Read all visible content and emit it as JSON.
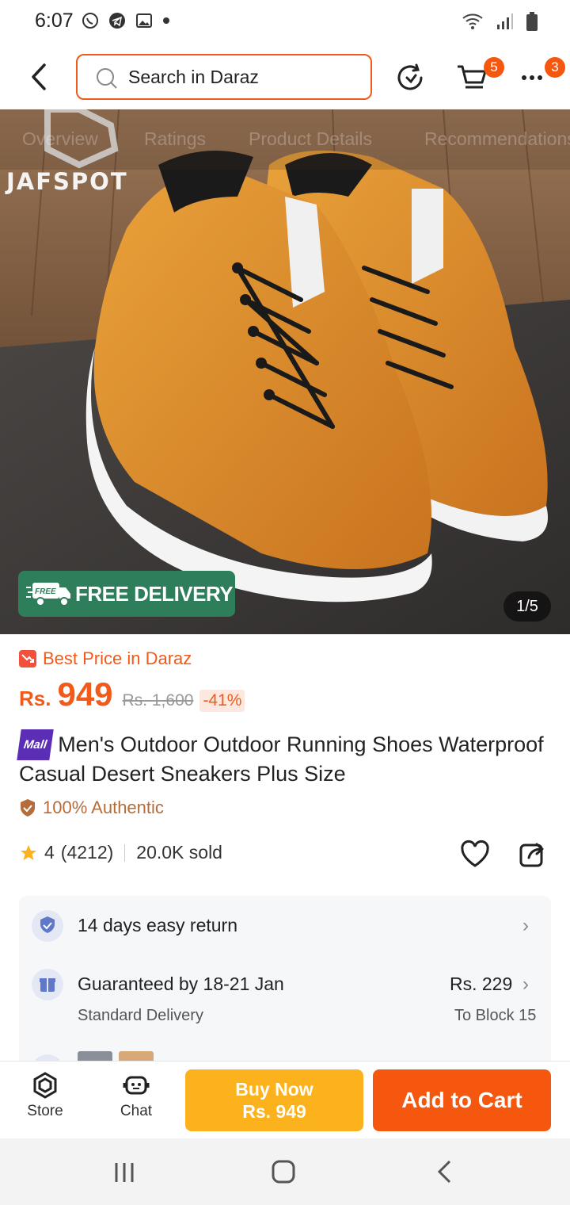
{
  "status_bar": {
    "time": "6:07"
  },
  "header": {
    "search_placeholder": "Search in Daraz",
    "cart_badge": "5",
    "more_badge": "3"
  },
  "gallery": {
    "tabs": [
      "Overview",
      "Ratings",
      "Product Details",
      "Recommendations"
    ],
    "brand": "JAFSPOT",
    "free_tag": "FREE",
    "free_delivery": "FREE DELIVERY",
    "counter": "1/5"
  },
  "price": {
    "best_price_label": "Best Price in Daraz",
    "currency": "Rs.",
    "current": "949",
    "original": "Rs. 1,600",
    "discount": "-41%"
  },
  "product": {
    "mall_label": "Mall",
    "title": "Men's Outdoor Outdoor Running Shoes Waterproof Casual Desert Sneakers Plus Size",
    "authentic": "100% Authentic",
    "rating": "4",
    "rating_count": "(4212)",
    "sold": "20.0K sold"
  },
  "services": {
    "return": "14 days easy return",
    "delivery_title": "Guaranteed by 18-21 Jan",
    "delivery_type": "Standard Delivery",
    "delivery_price": "Rs. 229",
    "delivery_to": "To Block 15"
  },
  "action_bar": {
    "store": "Store",
    "chat": "Chat",
    "buy_now": "Buy Now",
    "buy_now_price": "Rs. 949",
    "add_to_cart": "Add to Cart"
  },
  "colors": {
    "accent": "#f5570f",
    "buy_now": "#fbb21d",
    "free_delivery": "#2e7d5b"
  }
}
